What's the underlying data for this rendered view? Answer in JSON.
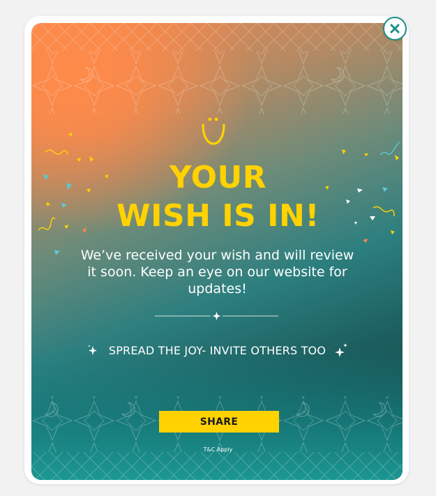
{
  "popup": {
    "headline_line1": "YOUR",
    "headline_line2": "WISH IS IN!",
    "message": "We’ve received your wish and will review it soon. Keep an eye on our website for updates!",
    "spread_text": "SPREAD THE JOY- INVITE OTHERS TOO",
    "share_label": "SHARE",
    "tnc_text": "T&C Apply"
  },
  "icons": {
    "close": "close-icon",
    "smile": "smile-icon",
    "sparkle": "sparkle-icon",
    "divider_star": "star-divider-icon"
  },
  "colors": {
    "accent_yellow": "#ffd200",
    "teal": "#1a8f86",
    "orange": "#f7874c",
    "text_white": "#ffffff"
  }
}
